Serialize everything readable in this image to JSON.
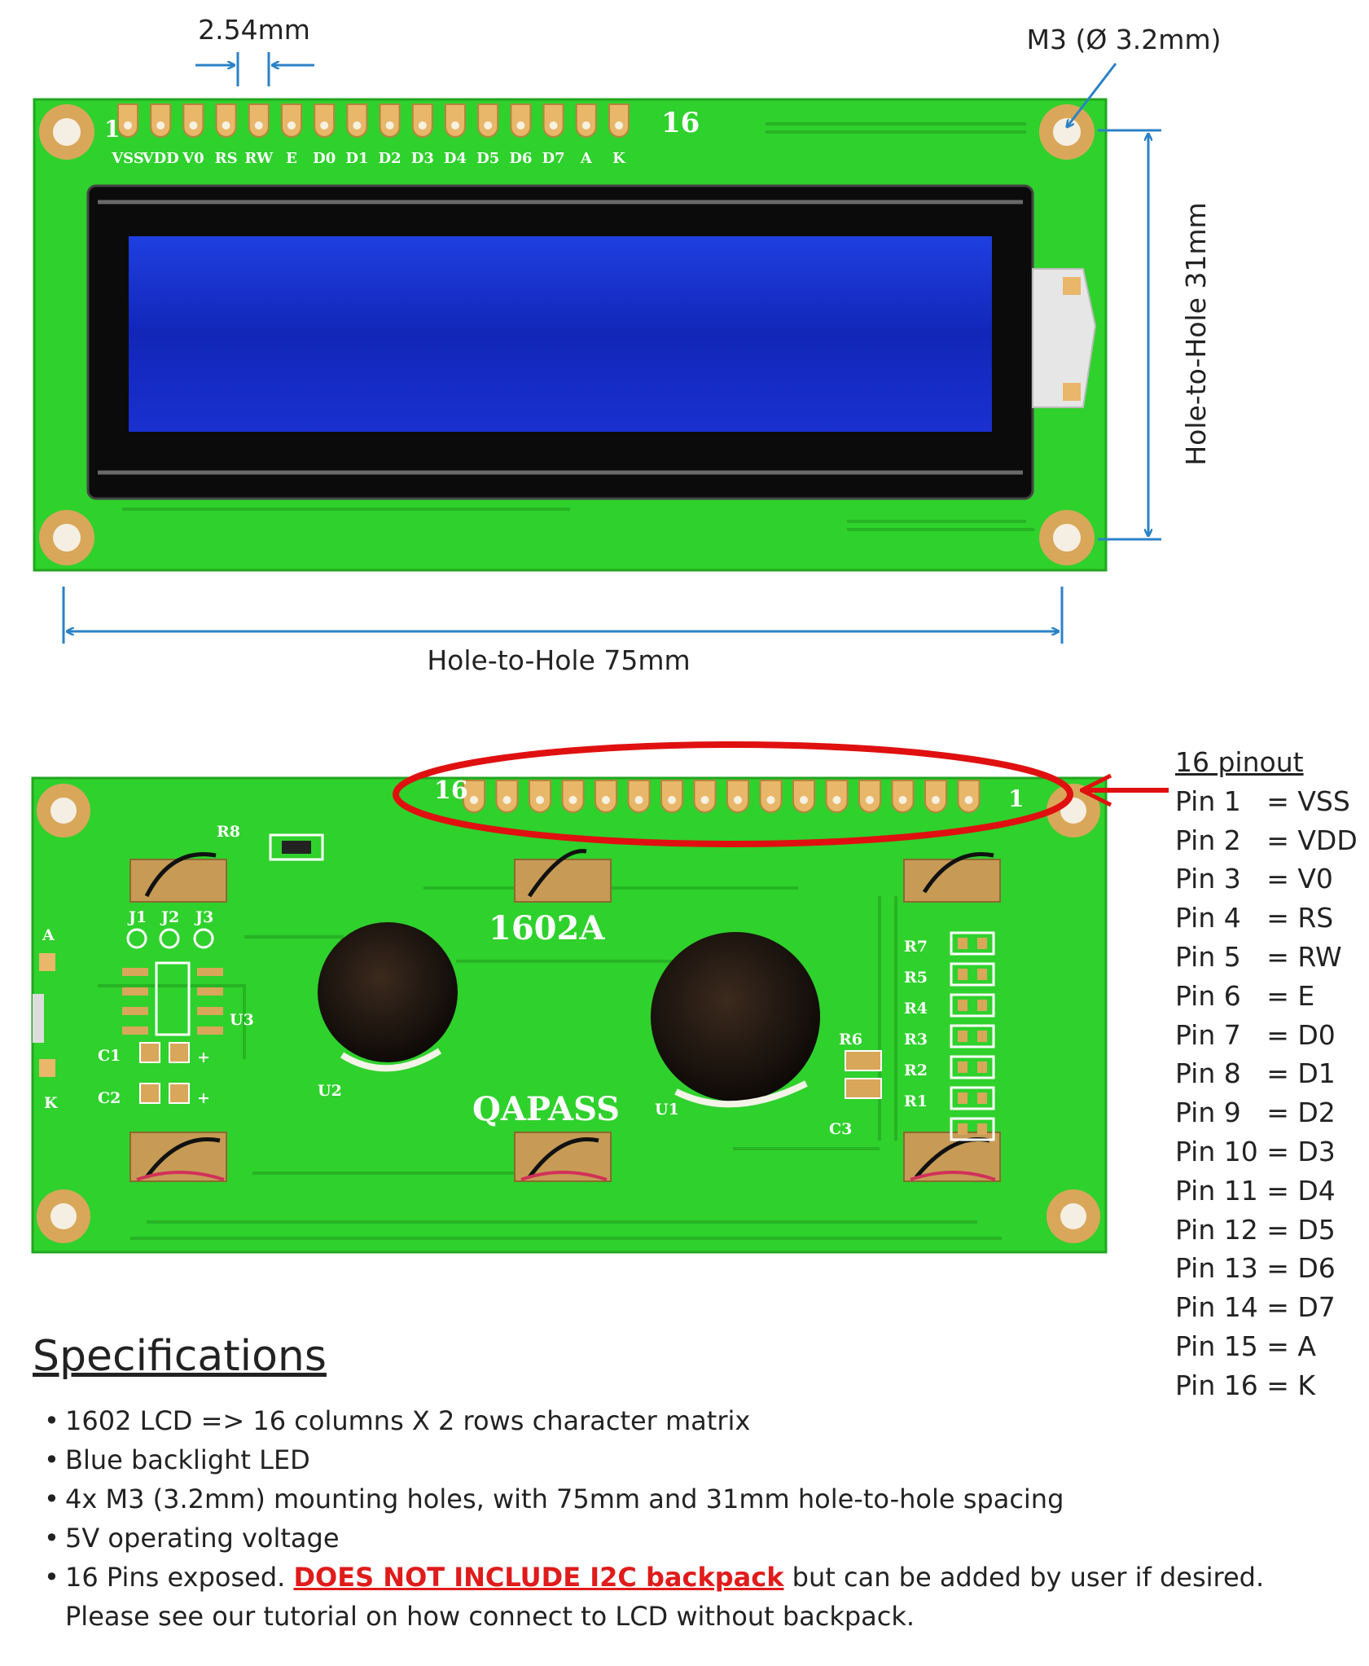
{
  "front": {
    "pitch_label": "2.54mm",
    "hole_label": "M3 (Ø 3.2mm)",
    "width_label": "Hole-to-Hole 75mm",
    "height_label": "Hole-to-Hole 31mm",
    "pin_first": "1",
    "pin_last": "16",
    "pin_labels": [
      "VSS",
      "VDD",
      "V0",
      "RS",
      "RW",
      "E",
      "D0",
      "D1",
      "D2",
      "D3",
      "D4",
      "D5",
      "D6",
      "D7",
      "A",
      "K"
    ]
  },
  "back": {
    "model": "1602A",
    "brand": "QAPASS",
    "pin_first": "16",
    "pin_last": "1",
    "silk": {
      "r8": "R8",
      "r7": "R7",
      "r5": "R5",
      "r4": "R4",
      "r3": "R3",
      "r2": "R2",
      "r1": "R1",
      "r6": "R6",
      "c1": "C1",
      "c2": "C2",
      "c3": "C3",
      "u1": "U1",
      "u2": "U2",
      "u3": "U3",
      "j1": "J1",
      "j2": "J2",
      "j3": "J3",
      "a": "A",
      "k": "K",
      "plus": "+"
    }
  },
  "pinout": {
    "title": "16 pinout",
    "rows": [
      "Pin 1   = VSS",
      "Pin 2   = VDD",
      "Pin 3   = V0",
      "Pin 4   = RS",
      "Pin 5   = RW",
      "Pin 6   = E",
      "Pin 7   = D0",
      "Pin 8   = D1",
      "Pin 9   = D2",
      "Pin 10 = D3",
      "Pin 11 = D4",
      "Pin 12 = D5",
      "Pin 13 = D6",
      "Pin 14 = D7",
      "Pin 15 = A",
      "Pin 16 = K"
    ]
  },
  "specs": {
    "title": "Specifications",
    "items": [
      "1602 LCD => 16 columns X 2 rows character matrix",
      "Blue backlight LED",
      "4x M3 (3.2mm) mounting holes, with 75mm and 31mm hole-to-hole spacing",
      "5V operating voltage"
    ],
    "last_pre": "16 Pins exposed. ",
    "last_warn": "DOES NOT INCLUDE I2C backpack",
    "last_post": " but can be added by user if desired.",
    "last_line2": "Please see our tutorial on how connect to LCD without backpack."
  },
  "colors": {
    "pcb": "#2fd12c",
    "pad": "#e8b76a",
    "lcd": "#1a2fd0",
    "dim": "#2b82c6",
    "circle": "#e01010"
  }
}
